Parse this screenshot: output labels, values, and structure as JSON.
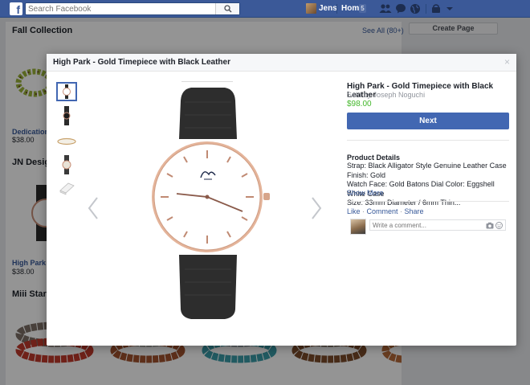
{
  "topbar": {
    "search_placeholder": "Search Facebook",
    "user_name": "Jens",
    "home_label": "Home",
    "home_badge": "5"
  },
  "background": {
    "section1_title": "Fall Collection",
    "see_all": "See All (80+)",
    "create_page": "Create Page",
    "item1_name": "Dedication I",
    "item1_price": "$38.00",
    "section2_title": "JN Design",
    "item2_name": "High Park - G",
    "item2_price": "$38.00",
    "section3_title": "Miii Starter"
  },
  "modal": {
    "header_title": "High Park - Gold Timepiece with Black Leather",
    "close_glyph": "×",
    "product_title": "High Park - Gold Timepiece with Black Leather",
    "seller": "Sold by Joseph Noguchi",
    "price": "$98.00",
    "next_label": "Next",
    "details_heading": "Product Details",
    "details_line1": "Strap: Black Alligator Style Genuine Leather Case Finish: Gold",
    "details_line2": "Watch Face: Gold Batons Dial Color: Eggshell White Case",
    "details_line3": "Size: 33mm Diameter / 6mm Thin...",
    "show_more": "Show More",
    "action_like": "Like",
    "action_comment": "Comment",
    "action_share": "Share",
    "comment_placeholder": "Write a comment..."
  },
  "colors": {
    "facebook_blue": "#3b5998",
    "button_blue": "#4267b2",
    "link_blue": "#365899",
    "price_green": "#42b72a"
  },
  "icons": [
    "facebook-logo-icon",
    "search-icon",
    "friends-icon",
    "messages-icon",
    "globe-icon",
    "lock-icon",
    "menu-icon",
    "close-icon",
    "chevron-left-icon",
    "chevron-right-icon",
    "camera-icon",
    "smiley-icon"
  ]
}
